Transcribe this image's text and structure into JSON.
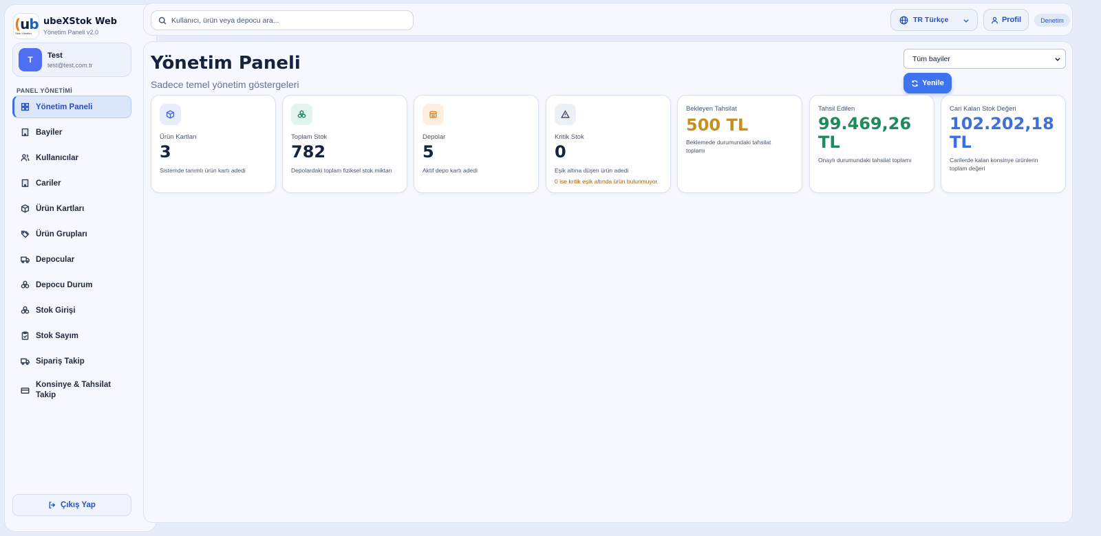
{
  "brand": {
    "logo_text": "ubeX",
    "logo_sub": "Stok Yönetim",
    "title": "ubeXStok Web",
    "subtitle": "Yönetim Paneli v2.0"
  },
  "user": {
    "initial": "T",
    "name": "Test",
    "email": "test@test.com.tr"
  },
  "sidebar": {
    "section_label": "PANEL YÖNETİMİ",
    "items": [
      {
        "label": "Yönetim Paneli",
        "icon": "grid-icon",
        "active": true
      },
      {
        "label": "Bayiler",
        "icon": "building-icon"
      },
      {
        "label": "Kullanıcılar",
        "icon": "users-icon"
      },
      {
        "label": "Cariler",
        "icon": "building-icon"
      },
      {
        "label": "Ürün Kartları",
        "icon": "box-icon"
      },
      {
        "label": "Ürün Grupları",
        "icon": "tags-icon"
      },
      {
        "label": "Depocular",
        "icon": "truck-icon"
      },
      {
        "label": "Depocu Durum",
        "icon": "boxes-icon"
      },
      {
        "label": "Stok Girişi",
        "icon": "boxes-icon"
      },
      {
        "label": "Stok Sayım",
        "icon": "clipboard-icon"
      },
      {
        "label": "Sipariş Takip",
        "icon": "truck-icon"
      },
      {
        "label": "Konsinye & Tahsilat Takip",
        "icon": "card-icon"
      }
    ],
    "logout_label": "Çıkış Yap"
  },
  "topbar": {
    "search_placeholder": "Kullanıcı, ürün veya depocu ara...",
    "language": "TR Türkçe",
    "profile_label": "Profil",
    "badge": "Denetim"
  },
  "main": {
    "title": "Yönetim Paneli",
    "subtitle": "Sadece temel yönetim göstergeleri",
    "dealer_select": "Tüm bayiler",
    "refresh_label": "Yenile"
  },
  "colors": {
    "accent": "#3d73ec",
    "pending": "#c8901a",
    "collected": "#1f8a5b",
    "stock_value": "#3d6fe0"
  },
  "stats": [
    {
      "icon": "box-icon",
      "label": "Ürün Kartları",
      "value": "3",
      "description": "Sistemde tanımlı ürün kartı adedi"
    },
    {
      "icon": "boxes-icon",
      "label": "Toplam Stok",
      "value": "782",
      "description": "Depolardaki toplam fiziksel stok miktarı"
    },
    {
      "icon": "warehouse-icon",
      "label": "Depolar",
      "value": "5",
      "description": "Aktif depo kartı adedi"
    },
    {
      "icon": "alert-icon",
      "label": "Kritik Stok",
      "value": "0",
      "description": "Eşik altına düşen ürün adedi",
      "note": "0 ise kritik eşik altında ürün bulunmuyor."
    },
    {
      "label": "Bekleyen Tahsilat",
      "value": "500 TL",
      "description": "Beklemede durumundaki tahsilat toplamı"
    },
    {
      "label": "Tahsil Edilen",
      "value": "99.469,26 TL",
      "description": "Onaylı durumundaki tahsilat toplamı"
    },
    {
      "label": "Cari Kalan Stok Değeri",
      "value": "102.202,18 TL",
      "description": "Carilerde kalan konsinye ürünlerin toplam değeri"
    }
  ]
}
